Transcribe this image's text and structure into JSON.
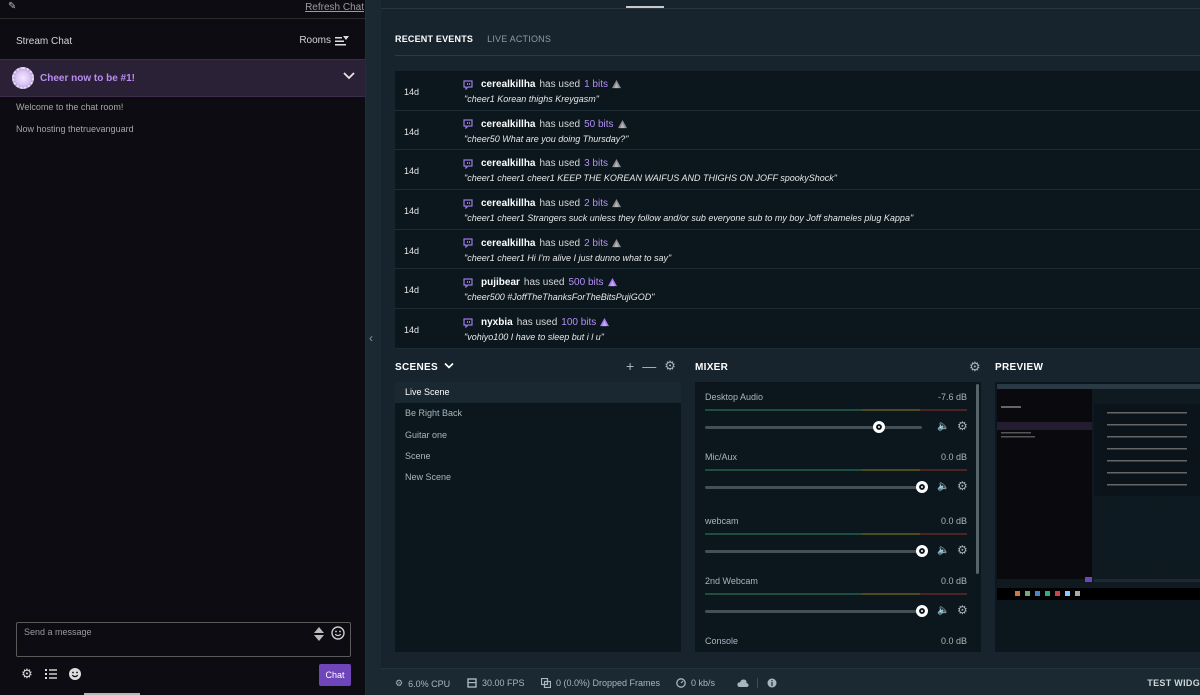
{
  "chat": {
    "refresh_label": "Refresh Chat",
    "title": "Stream Chat",
    "rooms_label": "Rooms",
    "cheer_text": "Cheer now to be #1!",
    "messages": [
      "Welcome to the chat room!",
      "Now hosting thetruevanguard"
    ],
    "input_placeholder": "Send a message",
    "send_label": "Chat"
  },
  "events": {
    "tabs": [
      "RECENT EVENTS",
      "LIVE ACTIONS"
    ],
    "items": [
      {
        "age": "14d",
        "user": "cerealkillha",
        "action": "has used",
        "bits": "1 bits",
        "gem": "gray",
        "message": "\"cheer1 Korean thighs Kreygasm\""
      },
      {
        "age": "14d",
        "user": "cerealkillha",
        "action": "has used",
        "bits": "50 bits",
        "gem": "gray",
        "message": "\"cheer50 What are you doing Thursday?\""
      },
      {
        "age": "14d",
        "user": "cerealkillha",
        "action": "has used",
        "bits": "3 bits",
        "gem": "gray",
        "message": "\"cheer1 cheer1 cheer1 KEEP THE KOREAN WAIFUS AND THIGHS ON JOFF spookyShock\""
      },
      {
        "age": "14d",
        "user": "cerealkillha",
        "action": "has used",
        "bits": "2 bits",
        "gem": "gray",
        "message": "\"cheer1 cheer1 Strangers suck unless they follow and/or sub everyone sub to my boy Joff shameles plug Kappa\""
      },
      {
        "age": "14d",
        "user": "cerealkillha",
        "action": "has used",
        "bits": "2 bits",
        "gem": "gray",
        "message": "\"cheer1 cheer1 Hi I'm alive I just dunno what to say\""
      },
      {
        "age": "14d",
        "user": "pujibear",
        "action": "has used",
        "bits": "500 bits",
        "gem": "purple",
        "message": "\"cheer500 #JoffTheThanksForTheBitsPujiGOD\""
      },
      {
        "age": "14d",
        "user": "nyxbia",
        "action": "has used",
        "bits": "100 bits",
        "gem": "purple",
        "message": "\"vohiyo100 I have to sleep but i l u\""
      }
    ]
  },
  "scenes": {
    "title": "SCENES",
    "items": [
      "Live Scene",
      "Be Right Back",
      "Guitar one",
      "Scene",
      "New Scene"
    ],
    "active_index": 0
  },
  "mixer": {
    "title": "MIXER",
    "sources": [
      {
        "name": "Desktop Audio",
        "db": "-7.6 dB",
        "volume": 0.8
      },
      {
        "name": "Mic/Aux",
        "db": "0.0 dB",
        "volume": 1.0
      },
      {
        "name": "webcam",
        "db": "0.0 dB",
        "volume": 1.0
      },
      {
        "name": "2nd Webcam",
        "db": "0.0 dB",
        "volume": 1.0
      },
      {
        "name": "Console",
        "db": "0.0 dB",
        "volume": 1.0
      }
    ]
  },
  "preview": {
    "title": "PREVIEW"
  },
  "status": {
    "cpu": "6.0% CPU",
    "fps": "30.00 FPS",
    "dropped": "0 (0.0%) Dropped Frames",
    "bandwidth": "0 kb/s",
    "test_label": "TEST WIDG"
  },
  "colors": {
    "accent": "#6f46b9",
    "bits": "#b48ff5",
    "panel": "#0b161d",
    "background": "#17242d"
  }
}
